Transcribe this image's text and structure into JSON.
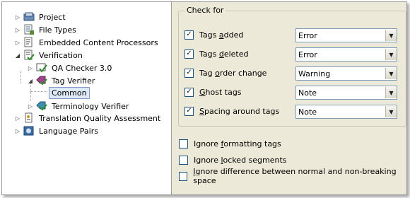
{
  "tree": {
    "items": [
      {
        "label": "Project",
        "icon": "project-icon"
      },
      {
        "label": "File Types",
        "icon": "file-types-icon"
      },
      {
        "label": "Embedded Content Processors",
        "icon": "embedded-content-icon"
      },
      {
        "label": "Verification",
        "icon": "verification-icon"
      },
      {
        "label": "QA Checker 3.0",
        "icon": "qa-checker-icon"
      },
      {
        "label": "Tag Verifier",
        "icon": "tag-verifier-icon"
      },
      {
        "label": "Common",
        "icon": ""
      },
      {
        "label": "Terminology Verifier",
        "icon": "terminology-verifier-icon"
      },
      {
        "label": "Translation Quality Assessment",
        "icon": "tqa-icon"
      },
      {
        "label": "Language Pairs",
        "icon": "language-pairs-icon"
      }
    ]
  },
  "check_for": {
    "title": "Check for",
    "rows": [
      {
        "pre": "Tags ",
        "u": "a",
        "post": "dded",
        "checked": true,
        "value": "Error"
      },
      {
        "pre": "Tags ",
        "u": "d",
        "post": "eleted",
        "checked": true,
        "value": "Error"
      },
      {
        "pre": "Tag ",
        "u": "o",
        "post": "rder change",
        "checked": true,
        "value": "Warning"
      },
      {
        "pre": "",
        "u": "G",
        "post": "host tags",
        "checked": true,
        "value": "Note"
      },
      {
        "pre": "",
        "u": "S",
        "post": "pacing around tags",
        "checked": true,
        "value": "Note"
      }
    ]
  },
  "options": [
    {
      "pre": "Ignore ",
      "u": "f",
      "post": "ormatting tags",
      "checked": false
    },
    {
      "pre": "Ignore ",
      "u": "l",
      "post": "ocked segments",
      "checked": false
    },
    {
      "pre": "",
      "u": "I",
      "post": "gnore difference between normal and non-breaking space",
      "checked": false
    }
  ],
  "glyphs": {
    "check": "✓",
    "collapsed": "▷",
    "expanded": "◢",
    "dropdown": "▼"
  }
}
